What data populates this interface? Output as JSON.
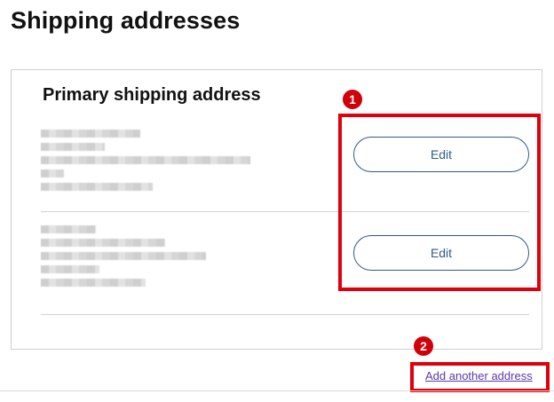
{
  "page": {
    "title": "Shipping addresses"
  },
  "card": {
    "heading": "Primary shipping address",
    "addresses": [
      {
        "edit_label": "Edit"
      },
      {
        "edit_label": "Edit"
      }
    ]
  },
  "annotations": {
    "badge_1": "1",
    "badge_2": "2",
    "highlight_color": "#e0000b"
  },
  "footer": {
    "add_address_link": "Add another address"
  }
}
